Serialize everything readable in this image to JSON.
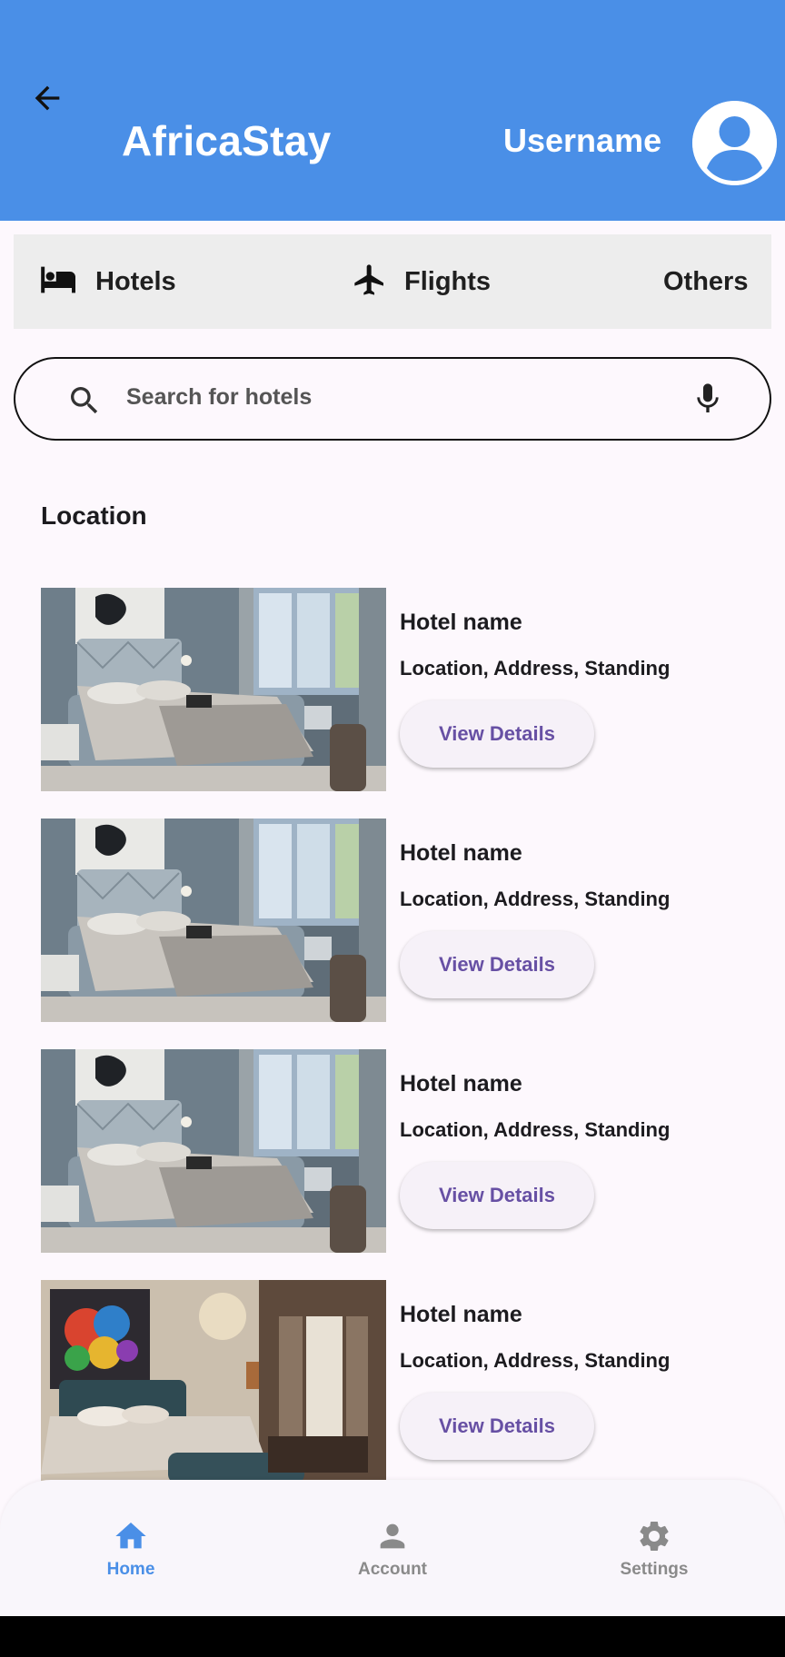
{
  "app": {
    "title": "AfricaStay",
    "username": "Username",
    "back_icon": "arrow-left-icon",
    "avatar_icon": "account-circle-icon",
    "brand_color": "#4a8fe7",
    "accent_color": "#6750a4"
  },
  "categories": [
    {
      "label": "Hotels",
      "icon": "bed-icon"
    },
    {
      "label": "Flights",
      "icon": "airplane-icon"
    },
    {
      "label": "Others"
    }
  ],
  "search": {
    "placeholder": "Search for hotels",
    "search_icon": "search-icon",
    "mic_icon": "microphone-icon"
  },
  "section_title": "Location",
  "hotels": [
    {
      "name": "Hotel name",
      "details": "Location, Address, Standing",
      "button": "View Details",
      "image": "modern-bedroom-photo"
    },
    {
      "name": "Hotel name",
      "details": "Location, Address, Standing",
      "button": "View Details",
      "image": "modern-bedroom-photo"
    },
    {
      "name": "Hotel name",
      "details": "Location, Address, Standing",
      "button": "View Details",
      "image": "modern-bedroom-photo"
    },
    {
      "name": "Hotel name",
      "details": "Location, Address, Standing",
      "button": "View Details",
      "image": "classic-bedroom-photo"
    }
  ],
  "bottom_nav": [
    {
      "label": "Home",
      "icon": "home-icon",
      "active": true,
      "color": "#4a8fe7"
    },
    {
      "label": "Account",
      "icon": "person-icon",
      "active": false,
      "color": "#8a8a8a"
    },
    {
      "label": "Settings",
      "icon": "gear-icon",
      "active": false,
      "color": "#8a8a8a"
    }
  ]
}
